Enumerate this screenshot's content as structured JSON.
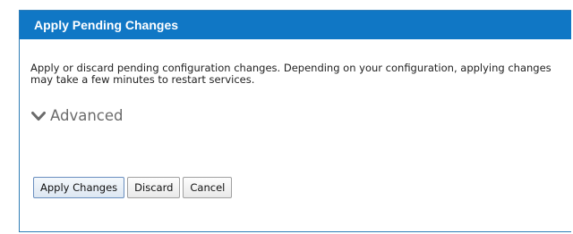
{
  "dialog": {
    "title": "Apply Pending Changes",
    "description": "Apply or discard pending configuration changes. Depending on your configuration, applying changes may take a few minutes to restart services.",
    "advanced_label": "Advanced",
    "title_bar_color": "#1077c5",
    "buttons": {
      "apply_label": "Apply Changes",
      "discard_label": "Discard",
      "cancel_label": "Cancel"
    }
  }
}
